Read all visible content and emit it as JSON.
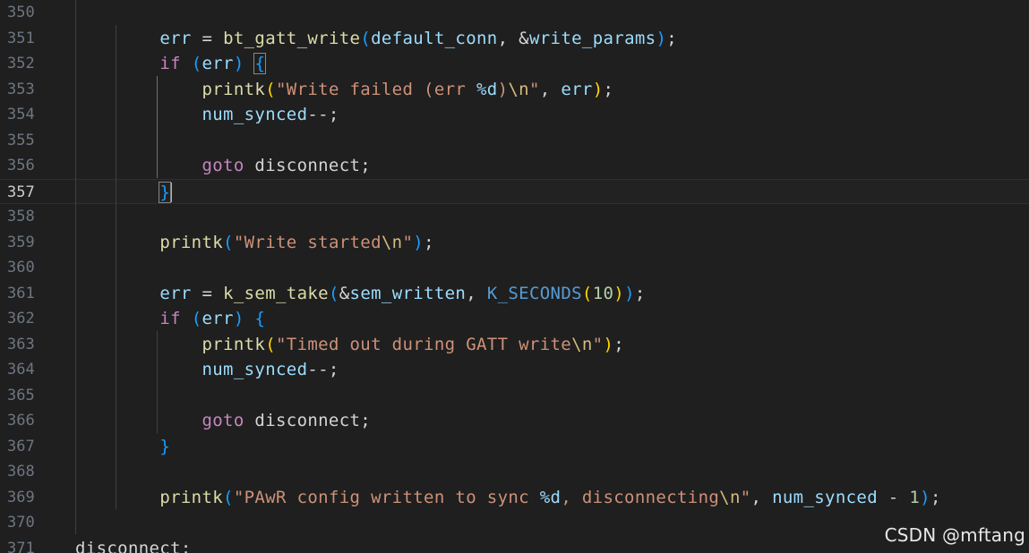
{
  "editor": {
    "theme_colors": {
      "background": "#1f1f1f",
      "line_number": "#6e7681",
      "keyword": "#c586c0",
      "function": "#dcdcaa",
      "variable": "#9cdcfe",
      "string": "#ce9178",
      "number": "#b5cea8",
      "constant": "#4fc1ff"
    },
    "current_line": "357",
    "lines": [
      {
        "num": "350",
        "tokens": []
      },
      {
        "num": "351",
        "tokens": [
          {
            "t": "        ",
            "c": ""
          },
          {
            "t": "err",
            "c": "var"
          },
          {
            "t": " = ",
            "c": "op"
          },
          {
            "t": "bt_gatt_write",
            "c": "fn"
          },
          {
            "t": "(",
            "c": "p3"
          },
          {
            "t": "default_conn",
            "c": "var"
          },
          {
            "t": ", &",
            "c": "op"
          },
          {
            "t": "write_params",
            "c": "var"
          },
          {
            "t": ")",
            "c": "p3"
          },
          {
            "t": ";",
            "c": "op"
          }
        ]
      },
      {
        "num": "352",
        "tokens": [
          {
            "t": "        ",
            "c": ""
          },
          {
            "t": "if",
            "c": "kw"
          },
          {
            "t": " ",
            "c": ""
          },
          {
            "t": "(",
            "c": "p3"
          },
          {
            "t": "err",
            "c": "var"
          },
          {
            "t": ")",
            "c": "p3"
          },
          {
            "t": " ",
            "c": ""
          },
          {
            "t": "{",
            "c": "p3 match"
          }
        ]
      },
      {
        "num": "353",
        "tokens": [
          {
            "t": "            ",
            "c": ""
          },
          {
            "t": "printk",
            "c": "fn"
          },
          {
            "t": "(",
            "c": "p1"
          },
          {
            "t": "\"Write failed (err ",
            "c": "str"
          },
          {
            "t": "%d",
            "c": "fmt"
          },
          {
            "t": ")",
            "c": "str"
          },
          {
            "t": "\\n",
            "c": "esc"
          },
          {
            "t": "\"",
            "c": "str"
          },
          {
            "t": ", ",
            "c": "op"
          },
          {
            "t": "err",
            "c": "var"
          },
          {
            "t": ")",
            "c": "p1"
          },
          {
            "t": ";",
            "c": "op"
          }
        ]
      },
      {
        "num": "354",
        "tokens": [
          {
            "t": "            ",
            "c": ""
          },
          {
            "t": "num_synced",
            "c": "var"
          },
          {
            "t": "--;",
            "c": "op"
          }
        ]
      },
      {
        "num": "355",
        "tokens": []
      },
      {
        "num": "356",
        "tokens": [
          {
            "t": "            ",
            "c": ""
          },
          {
            "t": "goto",
            "c": "kw"
          },
          {
            "t": " disconnect;",
            "c": "label"
          }
        ]
      },
      {
        "num": "357",
        "tokens": [
          {
            "t": "        ",
            "c": ""
          },
          {
            "t": "}",
            "c": "p3 match"
          }
        ]
      },
      {
        "num": "358",
        "tokens": []
      },
      {
        "num": "359",
        "tokens": [
          {
            "t": "        ",
            "c": ""
          },
          {
            "t": "printk",
            "c": "fn"
          },
          {
            "t": "(",
            "c": "p3"
          },
          {
            "t": "\"Write started",
            "c": "str"
          },
          {
            "t": "\\n",
            "c": "esc"
          },
          {
            "t": "\"",
            "c": "str"
          },
          {
            "t": ")",
            "c": "p3"
          },
          {
            "t": ";",
            "c": "op"
          }
        ]
      },
      {
        "num": "360",
        "tokens": []
      },
      {
        "num": "361",
        "tokens": [
          {
            "t": "        ",
            "c": ""
          },
          {
            "t": "err",
            "c": "var"
          },
          {
            "t": " = ",
            "c": "op"
          },
          {
            "t": "k_sem_take",
            "c": "fn"
          },
          {
            "t": "(",
            "c": "p3"
          },
          {
            "t": "&",
            "c": "op"
          },
          {
            "t": "sem_written",
            "c": "var"
          },
          {
            "t": ", ",
            "c": "op"
          },
          {
            "t": "K_SECONDS",
            "c": "macro"
          },
          {
            "t": "(",
            "c": "p1"
          },
          {
            "t": "10",
            "c": "num"
          },
          {
            "t": ")",
            "c": "p1"
          },
          {
            "t": ")",
            "c": "p3"
          },
          {
            "t": ";",
            "c": "op"
          }
        ]
      },
      {
        "num": "362",
        "tokens": [
          {
            "t": "        ",
            "c": ""
          },
          {
            "t": "if",
            "c": "kw"
          },
          {
            "t": " ",
            "c": ""
          },
          {
            "t": "(",
            "c": "p3"
          },
          {
            "t": "err",
            "c": "var"
          },
          {
            "t": ")",
            "c": "p3"
          },
          {
            "t": " ",
            "c": ""
          },
          {
            "t": "{",
            "c": "p3"
          }
        ]
      },
      {
        "num": "363",
        "tokens": [
          {
            "t": "            ",
            "c": ""
          },
          {
            "t": "printk",
            "c": "fn"
          },
          {
            "t": "(",
            "c": "p1"
          },
          {
            "t": "\"Timed out during GATT write",
            "c": "str"
          },
          {
            "t": "\\n",
            "c": "esc"
          },
          {
            "t": "\"",
            "c": "str"
          },
          {
            "t": ")",
            "c": "p1"
          },
          {
            "t": ";",
            "c": "op"
          }
        ]
      },
      {
        "num": "364",
        "tokens": [
          {
            "t": "            ",
            "c": ""
          },
          {
            "t": "num_synced",
            "c": "var"
          },
          {
            "t": "--;",
            "c": "op"
          }
        ]
      },
      {
        "num": "365",
        "tokens": []
      },
      {
        "num": "366",
        "tokens": [
          {
            "t": "            ",
            "c": ""
          },
          {
            "t": "goto",
            "c": "kw"
          },
          {
            "t": " disconnect;",
            "c": "label"
          }
        ]
      },
      {
        "num": "367",
        "tokens": [
          {
            "t": "        ",
            "c": ""
          },
          {
            "t": "}",
            "c": "p3"
          }
        ]
      },
      {
        "num": "368",
        "tokens": []
      },
      {
        "num": "369",
        "tokens": [
          {
            "t": "        ",
            "c": ""
          },
          {
            "t": "printk",
            "c": "fn"
          },
          {
            "t": "(",
            "c": "p3"
          },
          {
            "t": "\"PAwR config written to sync ",
            "c": "str"
          },
          {
            "t": "%d",
            "c": "fmt"
          },
          {
            "t": ", disconnecting",
            "c": "str"
          },
          {
            "t": "\\n",
            "c": "esc"
          },
          {
            "t": "\"",
            "c": "str"
          },
          {
            "t": ", ",
            "c": "op"
          },
          {
            "t": "num_synced",
            "c": "var"
          },
          {
            "t": " - ",
            "c": "op"
          },
          {
            "t": "1",
            "c": "num"
          },
          {
            "t": ")",
            "c": "p3"
          },
          {
            "t": ";",
            "c": "op"
          }
        ]
      },
      {
        "num": "370",
        "tokens": []
      },
      {
        "num": "371",
        "tokens": [
          {
            "t": "disconnect:",
            "c": "label"
          }
        ]
      }
    ]
  },
  "watermark": {
    "text": "CSDN @mftang"
  }
}
